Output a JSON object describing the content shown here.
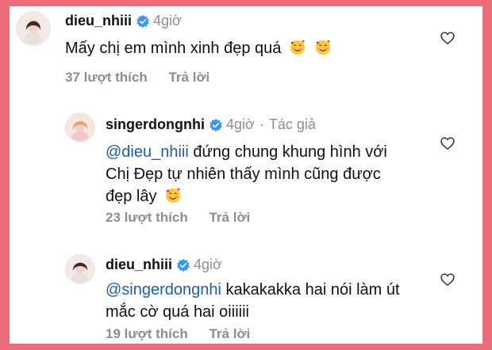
{
  "comments": [
    {
      "username": "dieu_nhiii",
      "time": "4giờ",
      "text": "Mấy chị em mình xinh đẹp quá",
      "likes": "37 lượt thích",
      "reply": "Trả lời"
    },
    {
      "username": "singerdongnhi",
      "time": "4giờ",
      "badge": "Tác giả",
      "mention": "@dieu_nhiii",
      "line1_rest": " đứng chung khung hình với",
      "line2": "Chị Đẹp tự nhiên thấy mình cũng được",
      "line3": "đẹp lây",
      "likes": "23 lượt thích",
      "reply": "Trả lời"
    },
    {
      "username": "dieu_nhiii",
      "time": "4giờ",
      "mention": "@singerdongnhi",
      "line1_rest": " kakakakka hai nói làm út",
      "line2": "mắc cờ quá hai oiiiiii",
      "likes": "19 lượt thích",
      "reply": "Trả lời"
    }
  ],
  "icons": {
    "verified": "verified-badge-icon",
    "like": "heart-icon",
    "emoji": "smiling-face-with-hearts-emoji"
  },
  "colors": {
    "frame": "#ec6d7a",
    "mention": "#1c5fa8",
    "verified": "#3897f0",
    "muted": "#8e8e8e"
  }
}
